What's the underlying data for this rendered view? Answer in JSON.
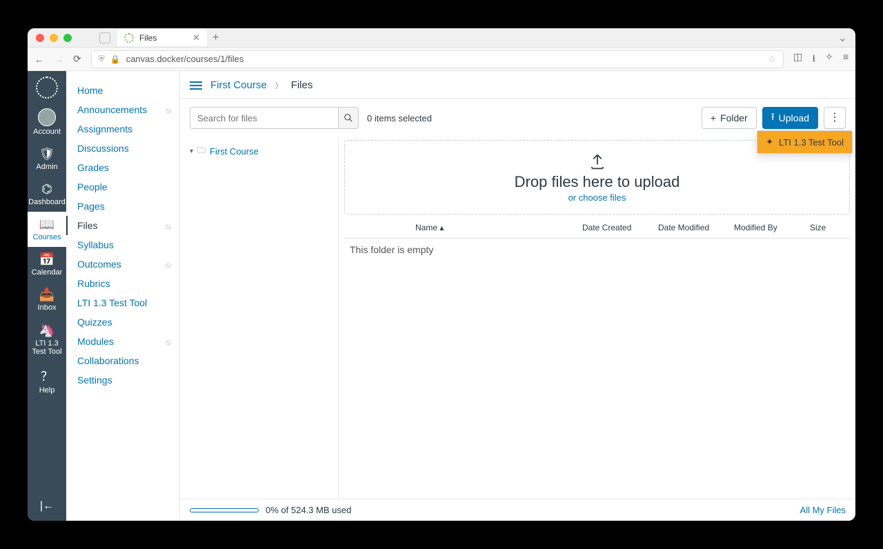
{
  "browser": {
    "tab_title": "Files",
    "url": "canvas.docker/courses/1/files"
  },
  "global_nav": {
    "items": [
      {
        "label": "Account"
      },
      {
        "label": "Admin"
      },
      {
        "label": "Dashboard"
      },
      {
        "label": "Courses"
      },
      {
        "label": "Calendar"
      },
      {
        "label": "Inbox"
      },
      {
        "label": "LTI 1.3 Test Tool"
      },
      {
        "label": "Help"
      }
    ]
  },
  "course_nav": {
    "items": [
      {
        "label": "Home",
        "hidden": false
      },
      {
        "label": "Announcements",
        "hidden": true
      },
      {
        "label": "Assignments",
        "hidden": false
      },
      {
        "label": "Discussions",
        "hidden": false
      },
      {
        "label": "Grades",
        "hidden": false
      },
      {
        "label": "People",
        "hidden": false
      },
      {
        "label": "Pages",
        "hidden": false
      },
      {
        "label": "Files",
        "hidden": true,
        "active": true
      },
      {
        "label": "Syllabus",
        "hidden": false
      },
      {
        "label": "Outcomes",
        "hidden": true
      },
      {
        "label": "Rubrics",
        "hidden": false
      },
      {
        "label": "LTI 1.3 Test Tool",
        "hidden": false
      },
      {
        "label": "Quizzes",
        "hidden": false
      },
      {
        "label": "Modules",
        "hidden": true
      },
      {
        "label": "Collaborations",
        "hidden": false
      },
      {
        "label": "Settings",
        "hidden": false
      }
    ]
  },
  "breadcrumb": {
    "course": "First Course",
    "page": "Files"
  },
  "toolbar": {
    "search_placeholder": "Search for files",
    "selected_text": "0 items selected",
    "folder_btn": "Folder",
    "upload_btn": "Upload"
  },
  "tree": {
    "root": "First Course"
  },
  "dropzone": {
    "heading": "Drop files here to upload",
    "link": "or choose files"
  },
  "table": {
    "columns": {
      "name": "Name",
      "created": "Date Created",
      "modified": "Date Modified",
      "by": "Modified By",
      "size": "Size"
    },
    "empty": "This folder is empty"
  },
  "footer": {
    "usage": "0% of 524.3 MB used",
    "all_files": "All My Files"
  },
  "popup": {
    "item": "LTI 1.3 Test Tool"
  }
}
